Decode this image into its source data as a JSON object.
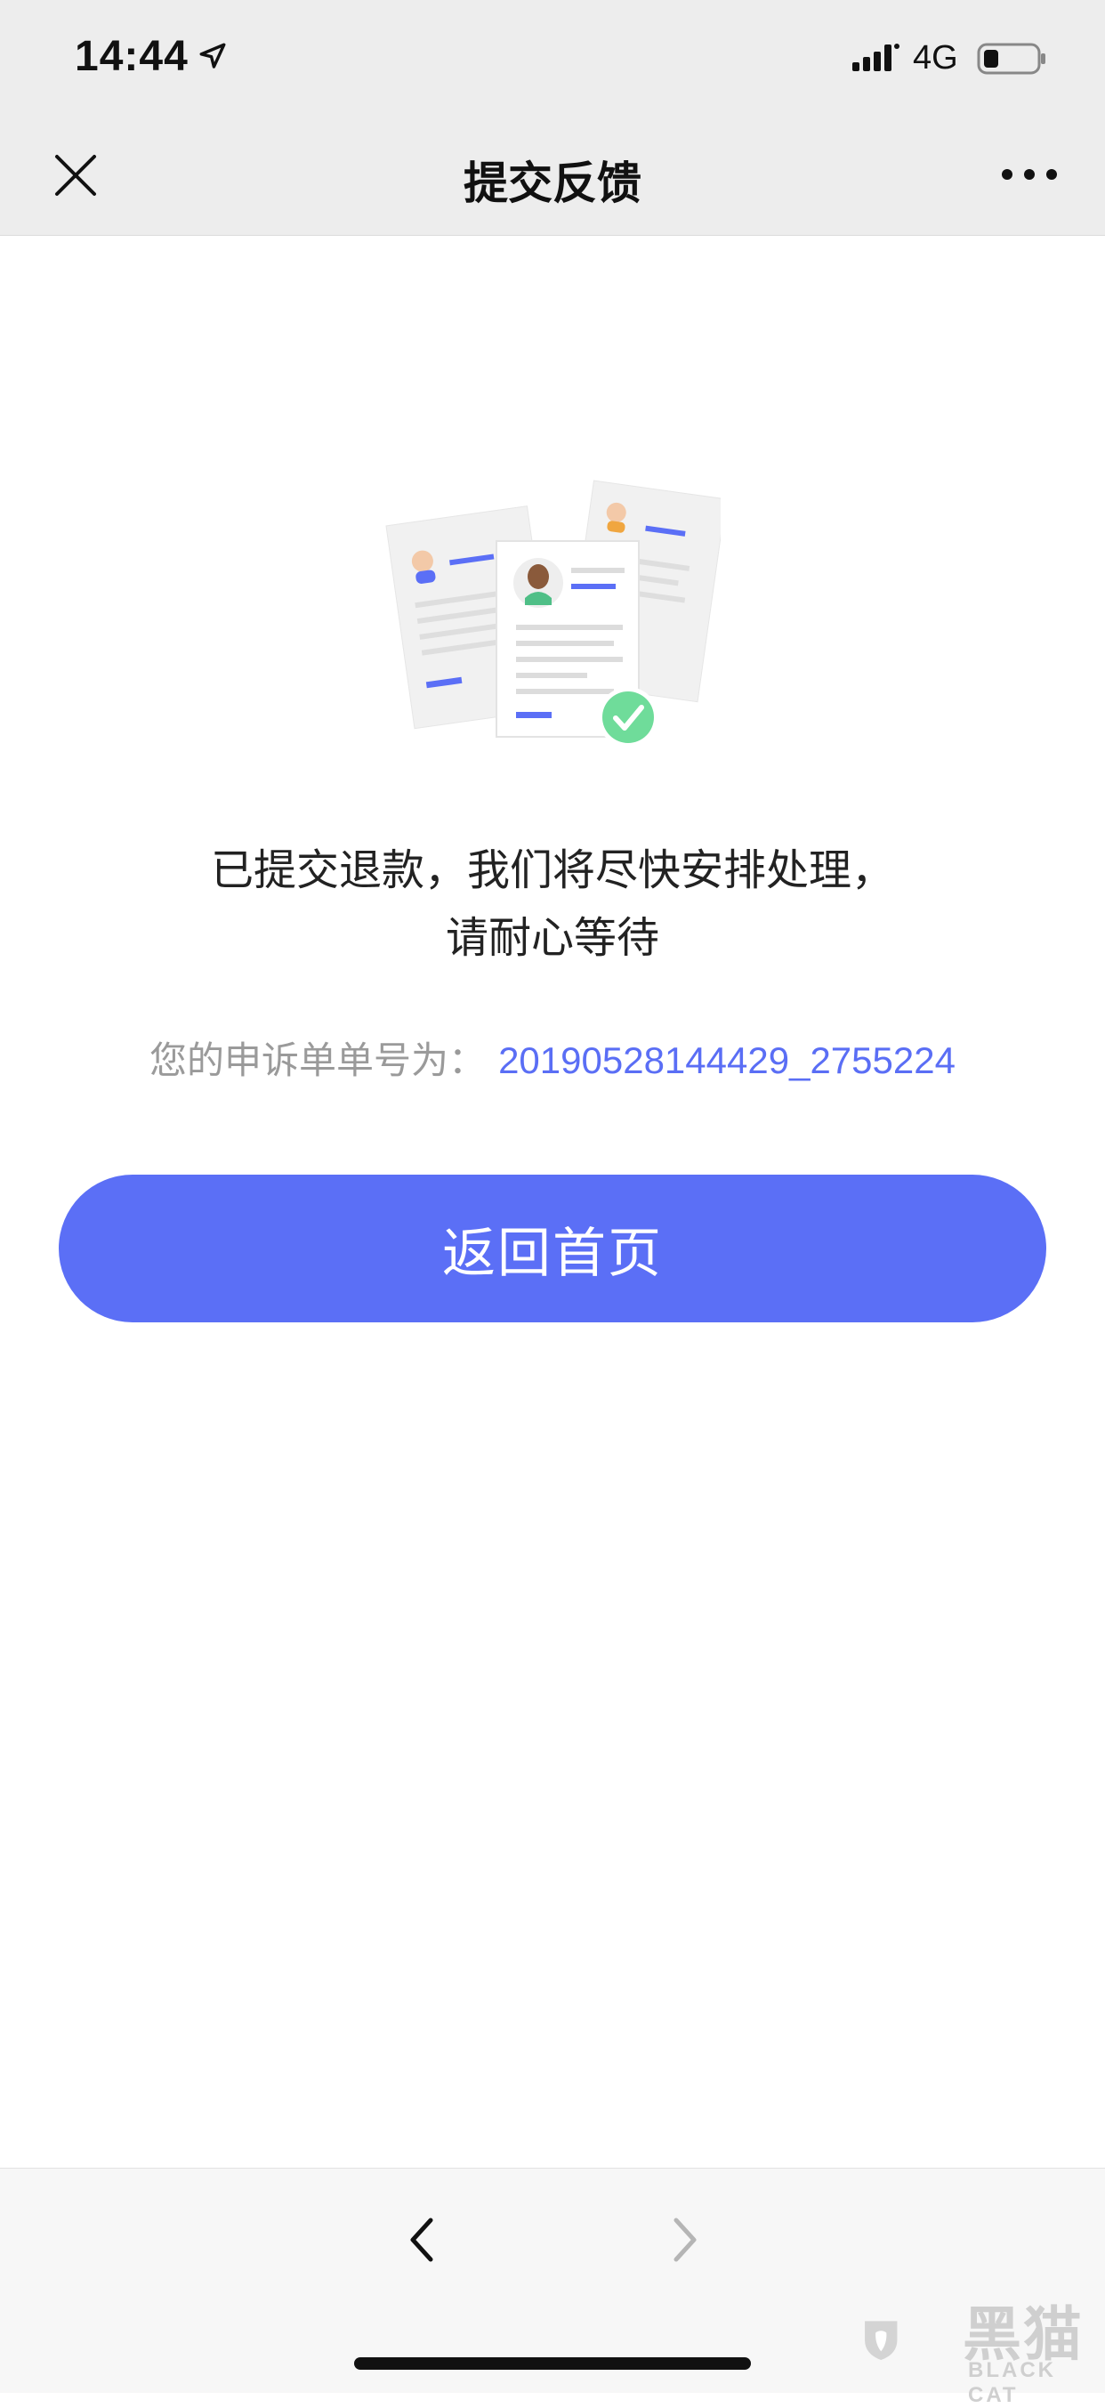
{
  "status_bar": {
    "time": "14:44",
    "network": "4G",
    "icons": [
      "location-arrow-icon",
      "signal-icon",
      "battery-icon"
    ]
  },
  "nav": {
    "title": "提交反馈",
    "close_icon": "close-icon",
    "more_icon": "more-icon"
  },
  "content": {
    "message_line1": "已提交退款，我们将尽快安排处理，",
    "message_line2": "请耐心等待",
    "order_label": "您的申诉单单号为：",
    "order_number": "20190528144429_2755224",
    "home_button": "返回首页"
  },
  "toolbar": {
    "back_icon": "chevron-left-icon",
    "forward_icon": "chevron-right-icon"
  },
  "watermark": {
    "logo_text": "黑猫",
    "sub_text": "BLACK CAT"
  },
  "colors": {
    "accent": "#5b6ff6",
    "link": "#5a6ef5",
    "success": "#6fdc9a",
    "bar_bg": "#ededed"
  }
}
